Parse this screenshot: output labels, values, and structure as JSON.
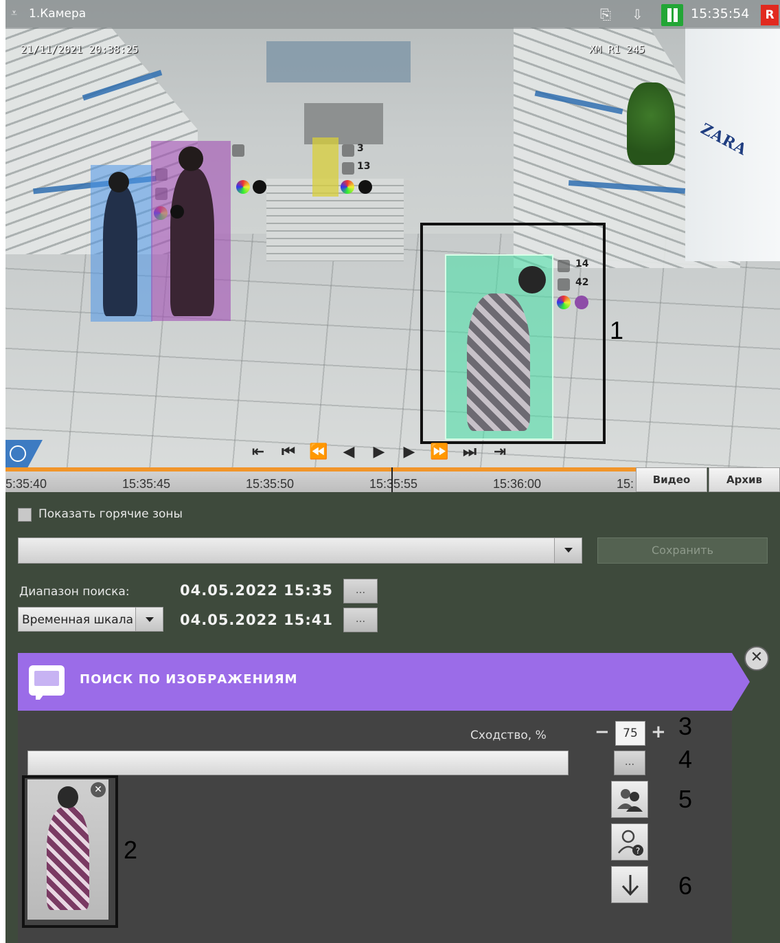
{
  "camera": {
    "title": "1.Камера",
    "time": "15:35:54",
    "rec_badge": "R",
    "osd_datetime": "21/11/2021 20:38:25",
    "osd_cam_id": "ХМ R1 245",
    "store_sign": "ZARA",
    "detections": [
      {
        "color": "#4d95e8",
        "width_tag": "",
        "height_tag": ""
      },
      {
        "color": "#a24fb4",
        "width_tag": "",
        "height_tag": ""
      },
      {
        "color": "#d8cf3a",
        "width_tag": "3",
        "height_tag": "13"
      },
      {
        "color": "#45e0a6",
        "width_tag": "14",
        "height_tag": "42"
      },
      {
        "color": "#888888",
        "width_tag": "14",
        "height_tag": "42"
      }
    ]
  },
  "callouts": {
    "one": "1",
    "two": "2",
    "three": "3",
    "four": "4",
    "five": "5",
    "six": "6"
  },
  "timeline": {
    "labels": [
      "5:35:40",
      "15:35:45",
      "15:35:50",
      "15:35:55",
      "15:36:00",
      "15:"
    ],
    "tab_video": "Видео",
    "tab_archive": "Архив"
  },
  "panel": {
    "hot_zones_label": "Показать горячие зоны",
    "save_label": "Сохранить",
    "search_range_label": "Диапазон поиска:",
    "date_from": "04.05.2022  15:35",
    "date_to": "04.05.2022  15:41",
    "dots": "...",
    "range_mode": "Временная шкала"
  },
  "image_search": {
    "title": "ПОИСК ПО ИЗОБРАЖЕНИЯМ",
    "similarity_label": "Сходство, %",
    "similarity_value": "75",
    "minus": "−",
    "plus": "+",
    "close": "✕"
  },
  "colors": {
    "accent": "#9b6ce8",
    "panel_bg": "#3e4a3c",
    "timeline_bar": "#f1952a",
    "play_green": "#23a636",
    "rec_red": "#e12a1f"
  }
}
